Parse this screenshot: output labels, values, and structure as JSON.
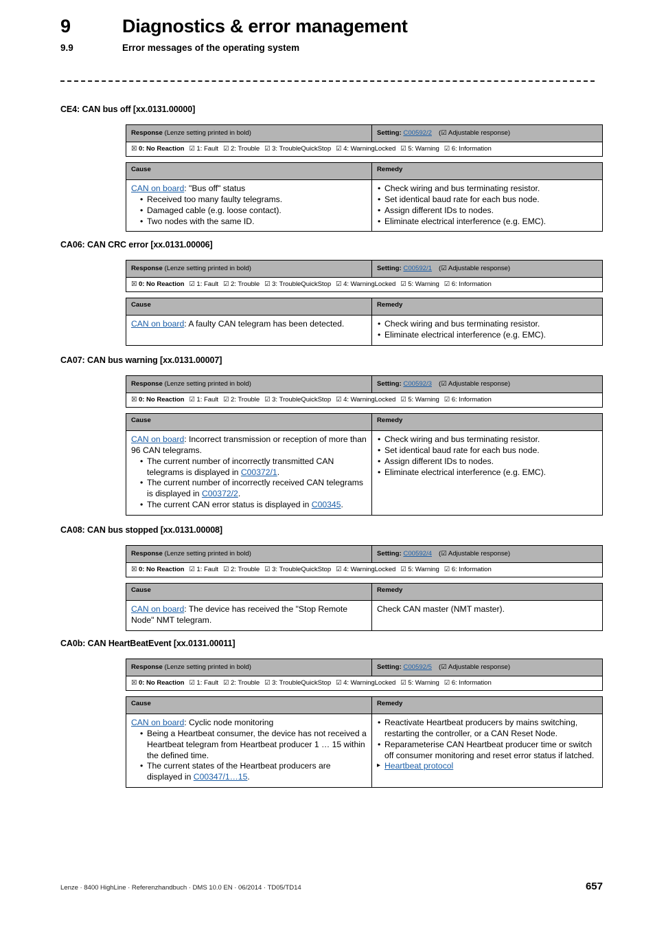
{
  "header": {
    "chapter_number": "9",
    "chapter_title": "Diagnostics & error management",
    "section_number": "9.9",
    "section_title": "Error messages of the operating system"
  },
  "response_legend": {
    "label_bold": "Response",
    "label_rest": " (Lenze setting printed in bold)",
    "setting_label": "Setting:",
    "adjustable_note": "(☑ Adjustable response)",
    "options": [
      {
        "mark": "☒",
        "text": "0: No Reaction",
        "bold": true
      },
      {
        "mark": "☑",
        "text": "1: Fault",
        "bold": false
      },
      {
        "mark": "☑",
        "text": "2: Trouble",
        "bold": false
      },
      {
        "mark": "☑",
        "text": "3: TroubleQuickStop",
        "bold": false
      },
      {
        "mark": "☑",
        "text": "4: WarningLocked",
        "bold": false
      },
      {
        "mark": "☑",
        "text": "5: Warning",
        "bold": false
      },
      {
        "mark": "☑",
        "text": "6: Information",
        "bold": false
      }
    ]
  },
  "table_headers": {
    "cause": "Cause",
    "remedy": "Remedy"
  },
  "link_color": "#1c5fa8",
  "header_bg": "#b4b4b4",
  "errors": [
    {
      "id": "CE4",
      "heading": "CE4: CAN bus off [xx.0131.00000]",
      "setting_code": "C00592/2",
      "cause": {
        "link": "CAN on board",
        "lead": ": \"Bus off\" status",
        "bullets": [
          "Received too many faulty telegrams.",
          "Damaged cable (e.g. loose contact).",
          "Two nodes with the same ID."
        ]
      },
      "remedy": {
        "bullets": [
          "Check wiring and bus terminating resistor.",
          "Set identical baud rate for each bus node.",
          "Assign different IDs to nodes.",
          "Eliminate electrical interference (e.g. EMC)."
        ]
      }
    },
    {
      "id": "CA06",
      "heading": "CA06: CAN CRC error [xx.0131.00006]",
      "setting_code": "C00592/1",
      "cause": {
        "link": "CAN on board",
        "lead": ": A faulty CAN telegram has been detected.",
        "bullets": []
      },
      "remedy": {
        "bullets": [
          "Check wiring and bus terminating resistor.",
          "Eliminate electrical interference (e.g. EMC)."
        ]
      }
    },
    {
      "id": "CA07",
      "heading": "CA07: CAN bus warning [xx.0131.00007]",
      "setting_code": "C00592/3",
      "cause": {
        "link": "CAN on board",
        "lead": ": Incorrect transmission or reception of more than 96 CAN telegrams.",
        "bullets": [
          "The current number of incorrectly transmitted CAN telegrams is displayed in C00372/1.",
          "The current number of incorrectly received CAN telegrams is displayed in C00372/2.",
          "The current CAN error status is displayed in C00345."
        ],
        "bullet_links": [
          "C00372/1",
          "C00372/2",
          "C00345"
        ]
      },
      "remedy": {
        "bullets": [
          "Check wiring and bus terminating resistor.",
          "Set identical baud rate for each bus node.",
          "Assign different IDs to nodes.",
          "Eliminate electrical interference (e.g. EMC)."
        ]
      }
    },
    {
      "id": "CA08",
      "heading": "CA08: CAN bus stopped [xx.0131.00008]",
      "setting_code": "C00592/4",
      "cause": {
        "link": "CAN on board",
        "lead": ": The device has received the \"Stop Remote Node\" NMT telegram.",
        "bullets": []
      },
      "remedy": {
        "plain": "Check CAN master (NMT master).",
        "bullets": []
      }
    },
    {
      "id": "CA0b",
      "heading": "CA0b: CAN HeartBeatEvent [xx.0131.00011]",
      "setting_code": "C00592/5",
      "cause": {
        "link": "CAN on board",
        "lead": ": Cyclic node monitoring",
        "bullets": [
          "Being a Heartbeat consumer, the device has not received a Heartbeat telegram from Heartbeat producer 1 … 15 within the defined time.",
          "The current states of the Heartbeat producers are displayed in C00347/1…15."
        ],
        "bullet_links": [
          "C00347/1…15"
        ]
      },
      "remedy": {
        "bullets": [
          "Reactivate Heartbeat producers by mains switching, restarting the controller, or a CAN Reset Node.",
          "Reparameterise CAN Heartbeat producer time or switch off consumer monitoring and reset error status if latched."
        ],
        "cross_reference": "Heartbeat protocol"
      }
    }
  ],
  "footer": {
    "text": "Lenze · 8400 HighLine · Referenzhandbuch · DMS 10.0 EN · 06/2014 · TD05/TD14",
    "page_number": "657"
  }
}
